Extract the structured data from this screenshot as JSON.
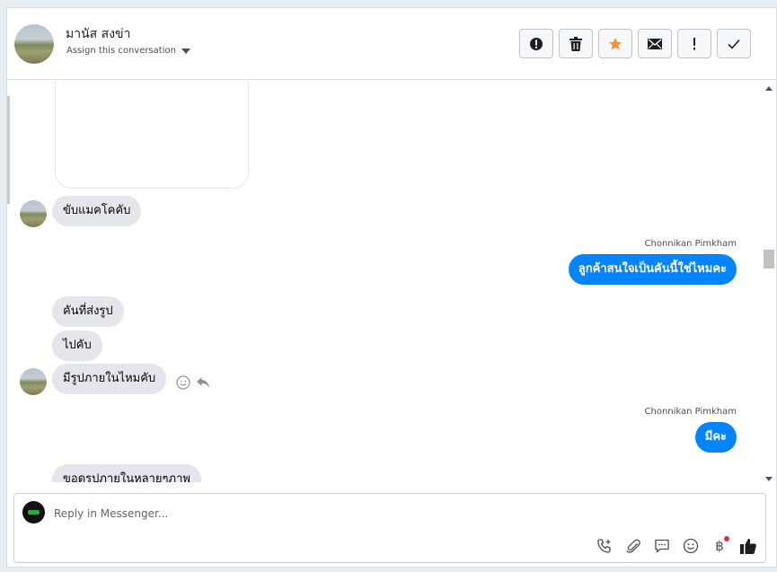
{
  "header": {
    "contact_name": "มานัส สงข่า",
    "assign_label": "Assign this conversation",
    "actions": [
      {
        "name": "spam-button",
        "icon": "alert-circle-icon"
      },
      {
        "name": "delete-button",
        "icon": "trash-icon"
      },
      {
        "name": "star-button",
        "icon": "star-icon"
      },
      {
        "name": "mark-unread-button",
        "icon": "envelope-icon"
      },
      {
        "name": "follow-up-button",
        "icon": "exclamation-icon"
      },
      {
        "name": "mark-done-button",
        "icon": "checkmark-icon"
      }
    ]
  },
  "messages": [
    {
      "type": "incoming",
      "text": "ขับแมคโคคับ"
    },
    {
      "type": "outgoing",
      "sender": "Chonnikan Pimkham",
      "text": "ลูกค้าสนใจเป็นคันนี้ใช่ไหมคะ"
    },
    {
      "type": "incoming",
      "text": "คันที่ส่งรูป"
    },
    {
      "type": "incoming",
      "text": "ไปคับ"
    },
    {
      "type": "incoming",
      "text": "มีรูปภายในไหมคับ"
    },
    {
      "type": "outgoing",
      "sender": "Chonnikan Pimkham",
      "text": "มีคะ"
    },
    {
      "type": "incoming",
      "text": "ขอดูรูปภายในหลายๆภาพ"
    }
  ],
  "composer": {
    "placeholder": "Reply in Messenger...",
    "tools": [
      "call-icon",
      "attachment-icon",
      "saved-reply-icon",
      "emoji-icon",
      "payment-icon",
      "thumbs-up-icon"
    ]
  },
  "colors": {
    "outgoing_bubble": "#0084ff",
    "incoming_bubble": "#e4e6eb",
    "star": "#f7923a"
  }
}
